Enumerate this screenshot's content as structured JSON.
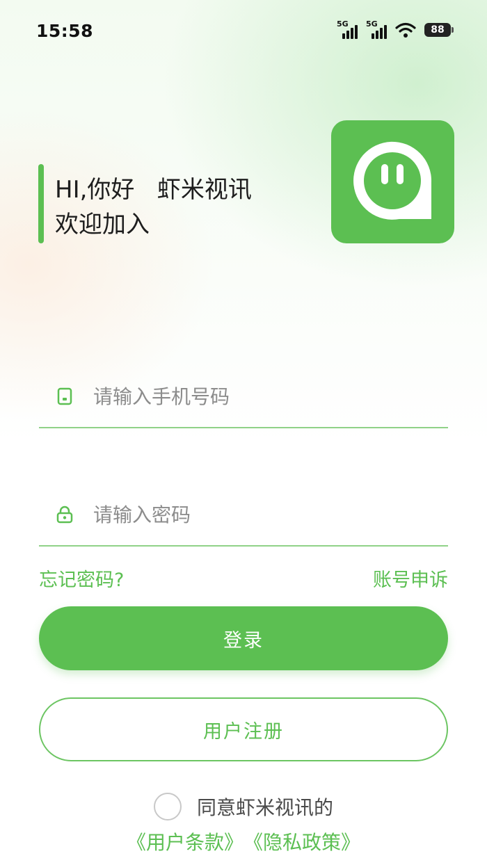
{
  "status_bar": {
    "time": "15:58",
    "network_1": "5G",
    "network_2": "5G",
    "battery": "88"
  },
  "welcome": {
    "line1": "HI,你好   虾米视讯",
    "line2": "欢迎加入"
  },
  "logo": {
    "icon": "chat-bubble-face-icon",
    "color": "#5cbf52"
  },
  "phone_field": {
    "icon": "phone-icon",
    "placeholder": "请输入手机号码"
  },
  "password_field": {
    "icon": "lock-icon",
    "placeholder": "请输入密码"
  },
  "links": {
    "forgot": "忘记密码?",
    "appeal": "账号申诉"
  },
  "buttons": {
    "login": "登录",
    "register": "用户注册"
  },
  "agreement": {
    "text": "同意虾米视讯的",
    "terms": "《用户条款》",
    "privacy": "《隐私政策》",
    "checked": false
  },
  "colors": {
    "accent": "#5cbf52"
  }
}
